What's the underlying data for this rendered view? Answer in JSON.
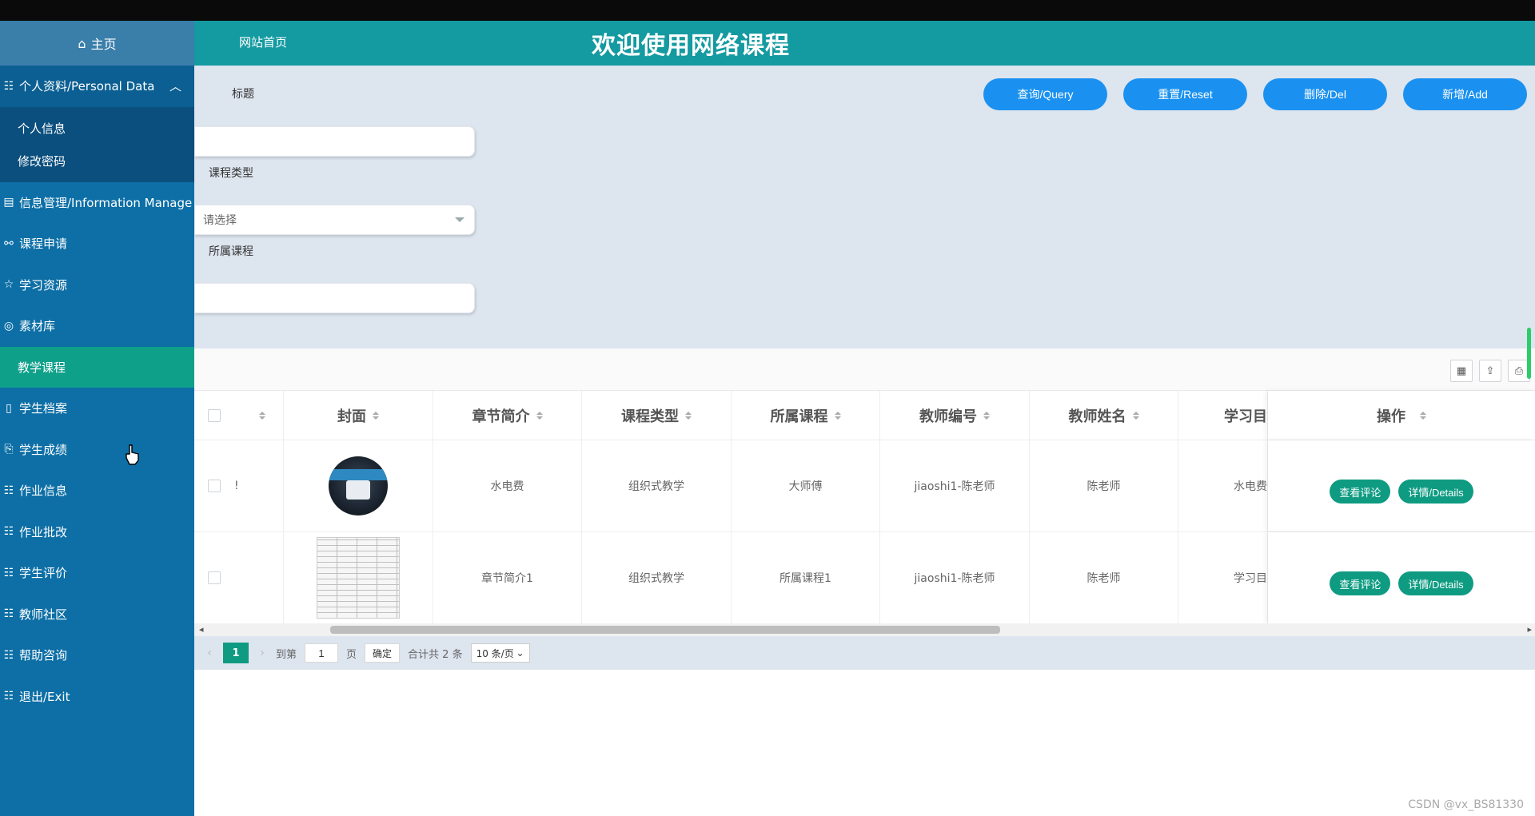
{
  "sidebar": {
    "home_label": "主页",
    "personal_data": "个人资料/Personal Data",
    "personal_sub": [
      "个人信息",
      "修改密码"
    ],
    "info_manage": "信息管理/Information Manage",
    "items": [
      "课程申请",
      "学习资源",
      "素材库"
    ],
    "active": "教学课程",
    "items2": [
      "学生档案",
      "学生成绩",
      "作业信息",
      "作业批改",
      "学生评价",
      "教师社区",
      "帮助咨询",
      "退出/Exit"
    ]
  },
  "header": {
    "home_link": "网站首页",
    "title": "欢迎使用网络课程"
  },
  "search": {
    "title_label": "标题",
    "title_value": "",
    "type_label": "课程类型",
    "type_placeholder": "请选择",
    "course_label": "所属课程",
    "course_value": ""
  },
  "buttons": {
    "query": "查询/Query",
    "reset": "重置/Reset",
    "delete": "删除/Del",
    "add": "新增/Add"
  },
  "table": {
    "columns": [
      "封面",
      "章节简介",
      "课程类型",
      "所属课程",
      "教师编号",
      "教师姓名",
      "学习目",
      "操作"
    ],
    "rows": [
      {
        "intro": "水电费",
        "type": "组织式教学",
        "course": "大师傅",
        "teacher_no": "jiaoshi1-陈老师",
        "teacher": "陈老师",
        "study": "水电费",
        "first": "!"
      },
      {
        "intro": "章节简介1",
        "type": "组织式教学",
        "course": "所属课程1",
        "teacher_no": "jiaoshi1-陈老师",
        "teacher": "陈老师",
        "study": "学习目",
        "first": ""
      }
    ],
    "op_comment": "查看评论",
    "op_details": "详情/Details"
  },
  "pager": {
    "current": "1",
    "goto": "到第",
    "goto_value": "1",
    "page": "页",
    "confirm": "确定",
    "total": "合计共 2 条",
    "per_page": "10 条/页"
  },
  "watermark": "CSDN @vx_BS81330",
  "colors": {
    "sidebar": "#0d6fa6",
    "header": "#149aa1",
    "active": "#0fa08a",
    "button": "#1a91f0",
    "op": "#0e9b82"
  }
}
